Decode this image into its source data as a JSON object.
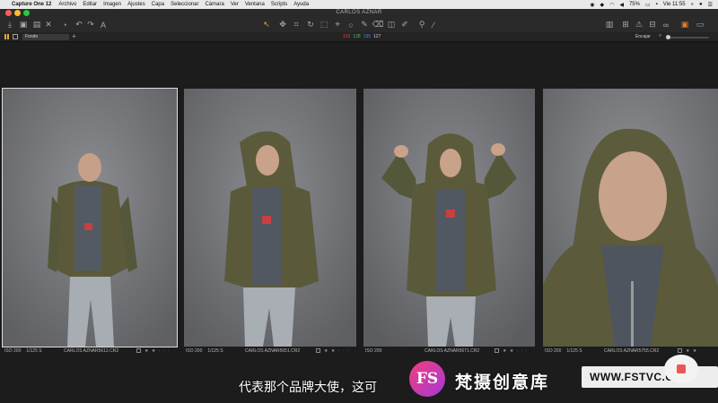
{
  "menubar": {
    "apple": "",
    "app_name": "Capture One 12",
    "items": [
      "Archivo",
      "Editar",
      "Imagen",
      "Ajustes",
      "Capa",
      "Seleccionar",
      "Cámara",
      "Ver",
      "Ventana",
      "Scripts",
      "Ayuda"
    ],
    "battery": "75%",
    "clock": "Vie 11:55"
  },
  "window": {
    "title": "CARLOS AZNAR"
  },
  "toolbar2": {
    "collection": "Fondo",
    "add": "+",
    "readout": {
      "r": "123",
      "g": "128",
      "b": "135",
      "l": "127"
    },
    "fit_label": "Encajar"
  },
  "thumbnails": [
    {
      "iso": "ISO 200",
      "shutter": "1/125 S",
      "filename": "CARLOS AZNAR5612.CR2",
      "rating": "★ ★ · · ·",
      "selected": true
    },
    {
      "iso": "ISO 200",
      "shutter": "1/125 S",
      "filename": "CARLOS AZNAR5651.CR2",
      "rating": "★ ★ · · ·",
      "selected": false
    },
    {
      "iso": "ISO 200",
      "shutter": "",
      "filename": "CARLOS AZNAR5671.CR2",
      "rating": "★ ★ · · ·",
      "selected": false
    },
    {
      "iso": "ISO 200",
      "shutter": "1/125 S",
      "filename": "CARLOS AZNAR5755.CR2",
      "rating": "★ ★",
      "selected": false
    }
  ],
  "subtitle": "代表那个品牌大使，这可",
  "watermark": {
    "badge": "FS",
    "name": "梵摄创意库",
    "url": "WWW.FSTVC.CC"
  },
  "colors": {
    "accent": "#e5a63b",
    "selection": "#dcdcdc",
    "background": "#1c1c1d"
  },
  "icons": [
    "import-icon",
    "camera-icon",
    "export-icon",
    "delete-icon",
    "undo-icon",
    "redo-icon",
    "text-icon",
    "cursor-icon",
    "pan-icon",
    "crop-icon",
    "rotate-icon",
    "keystone-icon",
    "spot-icon",
    "brush-icon",
    "eraser-icon",
    "gradient-icon",
    "picker-icon",
    "eyedropper-icon",
    "exposure-icon",
    "focus-icon",
    "warning-icon",
    "compare-icon",
    "glasses-icon",
    "variants-icon"
  ]
}
